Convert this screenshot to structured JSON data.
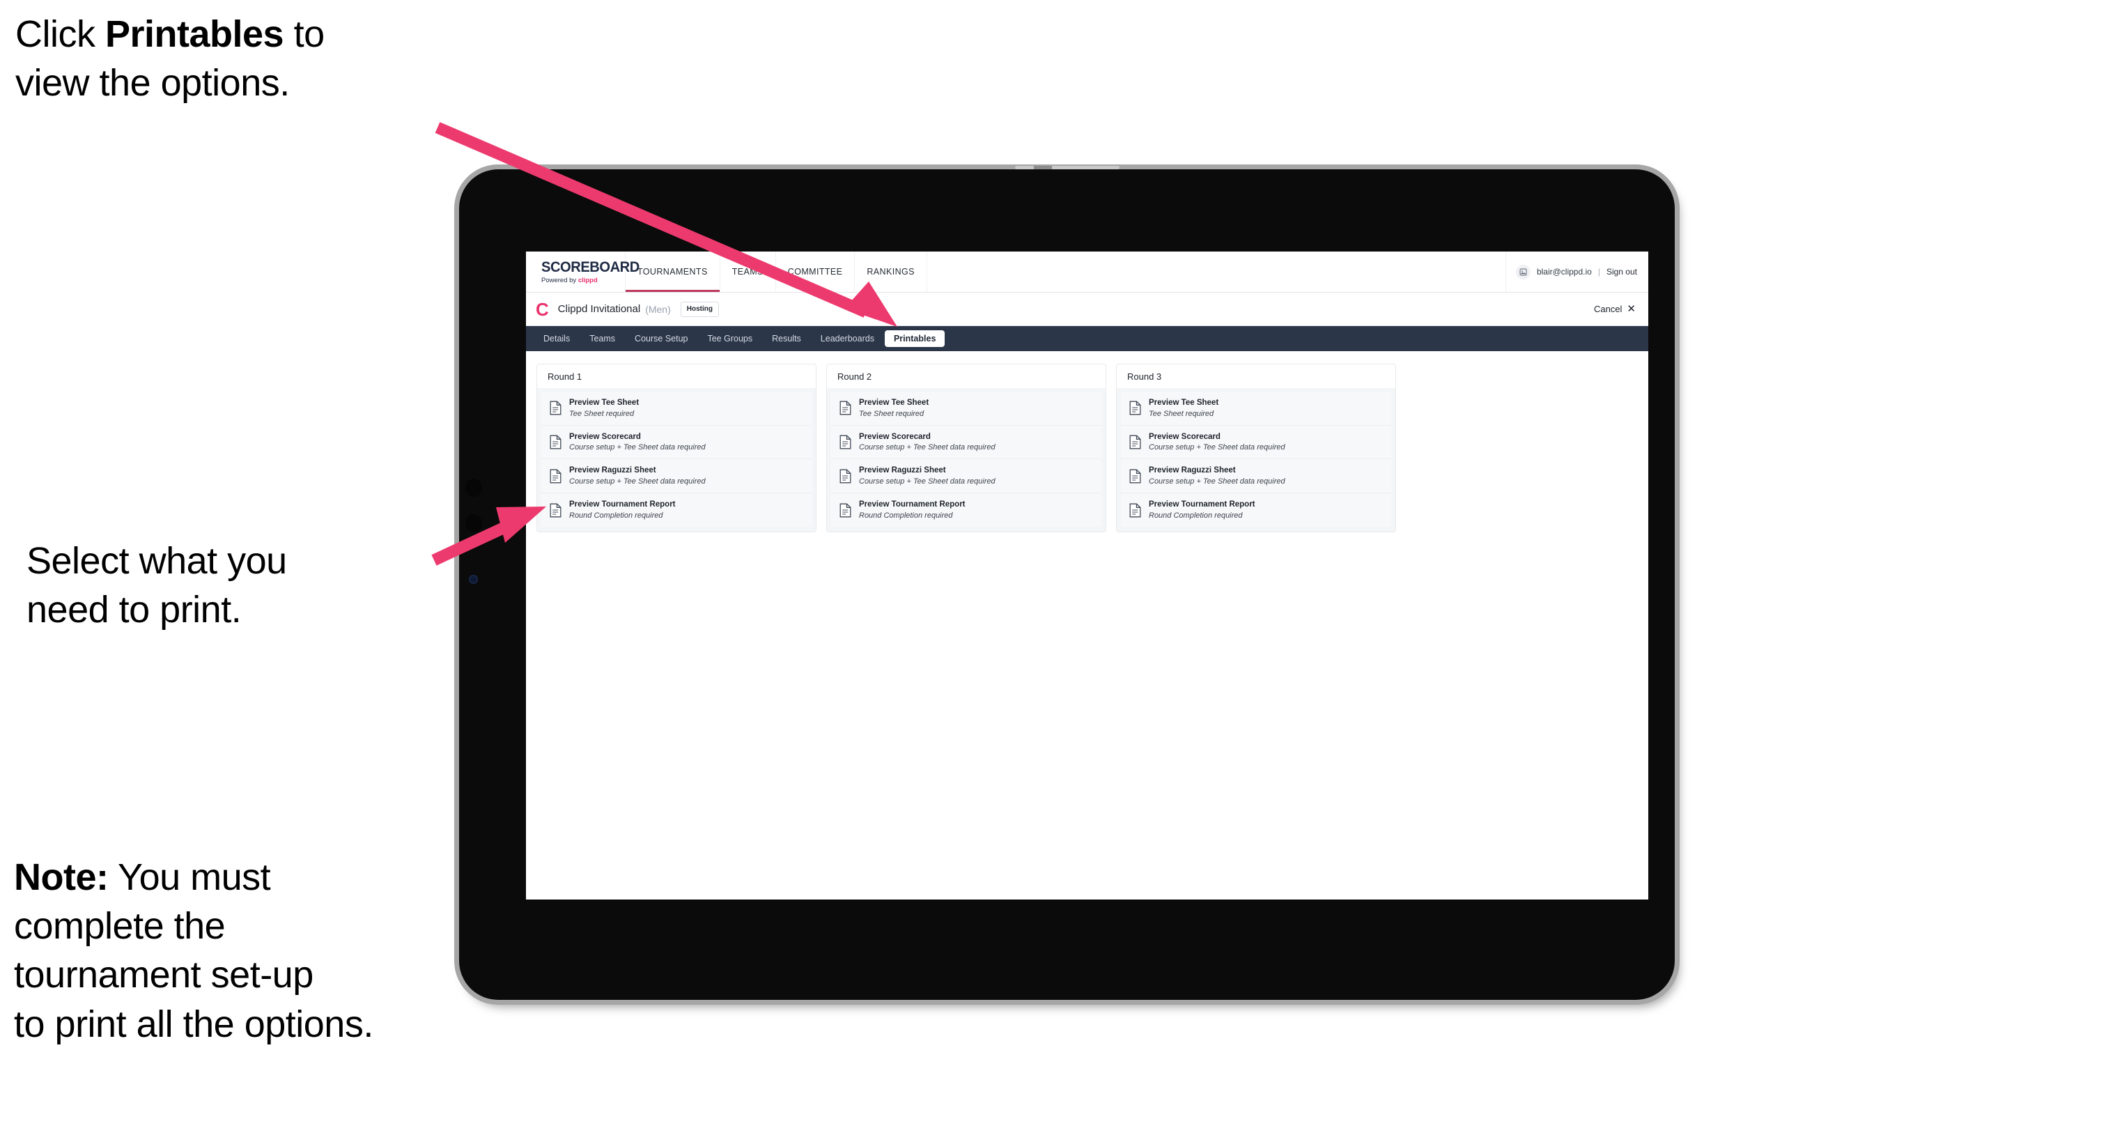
{
  "annotations": {
    "top": {
      "prefix": "Click ",
      "bold": "Printables",
      "suffix": " to\nview the options."
    },
    "middle": "Select what you\n need to print.",
    "note": {
      "bold": "Note:",
      "rest": " You must\ncomplete the\ntournament set-up\nto print all the options."
    }
  },
  "arrow_color": "#ED3A6E",
  "browser": {
    "topnav": {
      "brand_title": "SCOREBOARD",
      "brand_sub_prefix": "Powered by ",
      "brand_sub_accent": "clippd",
      "items": [
        {
          "label": "TOURNAMENTS",
          "active": true
        },
        {
          "label": "TEAMS",
          "active": false
        },
        {
          "label": "COMMITTEE",
          "active": false
        },
        {
          "label": "RANKINGS",
          "active": false
        }
      ],
      "user": {
        "avatar_icon": "user-avatar-icon",
        "email": "blair@clippd.io",
        "separator": "|",
        "signout_label": "Sign out"
      }
    },
    "tournament_bar": {
      "logo_letter": "C",
      "name": "Clippd Invitational",
      "gender": "(Men)",
      "status_badge": "Hosting",
      "cancel_label": "Cancel",
      "cancel_icon": "close-icon"
    },
    "subtabs": [
      {
        "label": "Details",
        "active": false
      },
      {
        "label": "Teams",
        "active": false
      },
      {
        "label": "Course Setup",
        "active": false
      },
      {
        "label": "Tee Groups",
        "active": false
      },
      {
        "label": "Results",
        "active": false
      },
      {
        "label": "Leaderboards",
        "active": false
      },
      {
        "label": "Printables",
        "active": true
      }
    ],
    "rounds": [
      {
        "title": "Round 1",
        "items": [
          {
            "title": "Preview Tee Sheet",
            "subtitle": "Tee Sheet required"
          },
          {
            "title": "Preview Scorecard",
            "subtitle": "Course setup + Tee Sheet data required"
          },
          {
            "title": "Preview Raguzzi Sheet",
            "subtitle": "Course setup + Tee Sheet data required"
          },
          {
            "title": "Preview Tournament Report",
            "subtitle": "Round Completion required"
          }
        ]
      },
      {
        "title": "Round 2",
        "items": [
          {
            "title": "Preview Tee Sheet",
            "subtitle": "Tee Sheet required"
          },
          {
            "title": "Preview Scorecard",
            "subtitle": "Course setup + Tee Sheet data required"
          },
          {
            "title": "Preview Raguzzi Sheet",
            "subtitle": "Course setup + Tee Sheet data required"
          },
          {
            "title": "Preview Tournament Report",
            "subtitle": "Round Completion required"
          }
        ]
      },
      {
        "title": "Round 3",
        "items": [
          {
            "title": "Preview Tee Sheet",
            "subtitle": "Tee Sheet required"
          },
          {
            "title": "Preview Scorecard",
            "subtitle": "Course setup + Tee Sheet data required"
          },
          {
            "title": "Preview Raguzzi Sheet",
            "subtitle": "Course setup + Tee Sheet data required"
          },
          {
            "title": "Preview Tournament Report",
            "subtitle": "Round Completion required"
          }
        ]
      }
    ]
  }
}
